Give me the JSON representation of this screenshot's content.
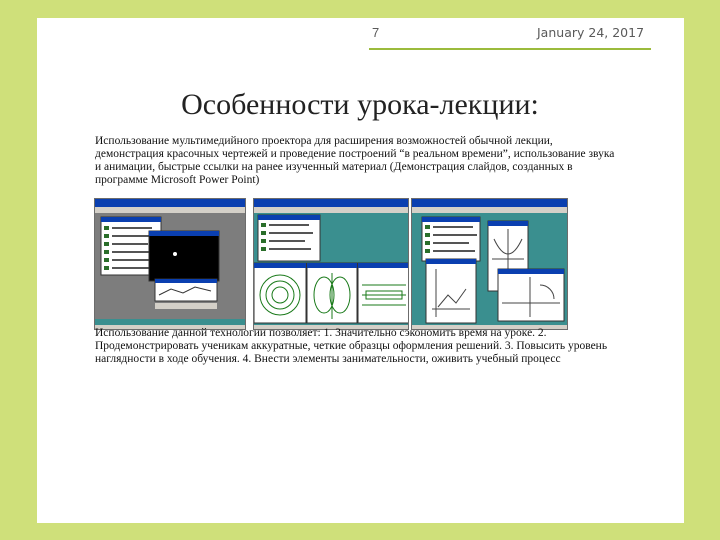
{
  "header": {
    "page_number": "7",
    "date": "January 24, 2017"
  },
  "slide": {
    "title": "Особенности урока-лекции:",
    "paragraph1": "Использование мультимедийного проектора для расширения возможностей обычной лекции, демонстрация красочных чертежей и проведение построений “в реальном времени”, использование звука и анимации, быстрые ссылки на ранее изученный материал (Демонстрация слайдов, созданных в программе Microsoft Power Point)",
    "paragraph2": "Использование данной технологии позволяет: 1. Значительно сэкономить время на уроке. 2. Продемонстрировать ученикам аккуратные, четкие образцы оформления решений. 3. Повысить уровень наглядности в ходе обучения. 4. Внести элементы занимательности, оживить учебный процесс"
  },
  "colors": {
    "accent": "#9bbb3c",
    "frame": "#cfe07a",
    "window_blue": "#0a3fb0",
    "desktop_teal": "#3a8f8f"
  }
}
